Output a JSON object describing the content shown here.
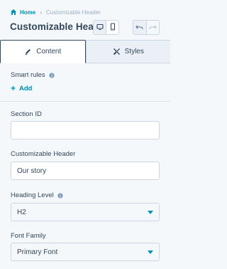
{
  "breadcrumb": {
    "home": "Home",
    "separator": "›",
    "current": "Customizable Header"
  },
  "title": "Customizable Hea…",
  "icons": {
    "home": "home-icon",
    "desktop": "desktop-icon",
    "mobile": "mobile-icon",
    "undo": "undo-icon",
    "redo": "redo-icon",
    "content_tab": "pencil-icon",
    "styles_tab": "styles-brush-icon",
    "info": "info-icon"
  },
  "tabs": [
    {
      "label": "Content",
      "active": true
    },
    {
      "label": "Styles",
      "active": false
    }
  ],
  "smart_rules": {
    "label": "Smart rules",
    "add_label": "Add"
  },
  "section_id": {
    "label": "Section ID",
    "value": ""
  },
  "customizable_header": {
    "label": "Customizable Header",
    "value": "Our story"
  },
  "heading_level": {
    "label": "Heading Level",
    "value": "H2"
  },
  "font_family": {
    "label": "Font Family",
    "value": "Primary Font"
  },
  "colors": {
    "accent": "#0091ae",
    "text": "#33475b",
    "background": "#f5f8fa",
    "border": "#cbd6e2"
  }
}
